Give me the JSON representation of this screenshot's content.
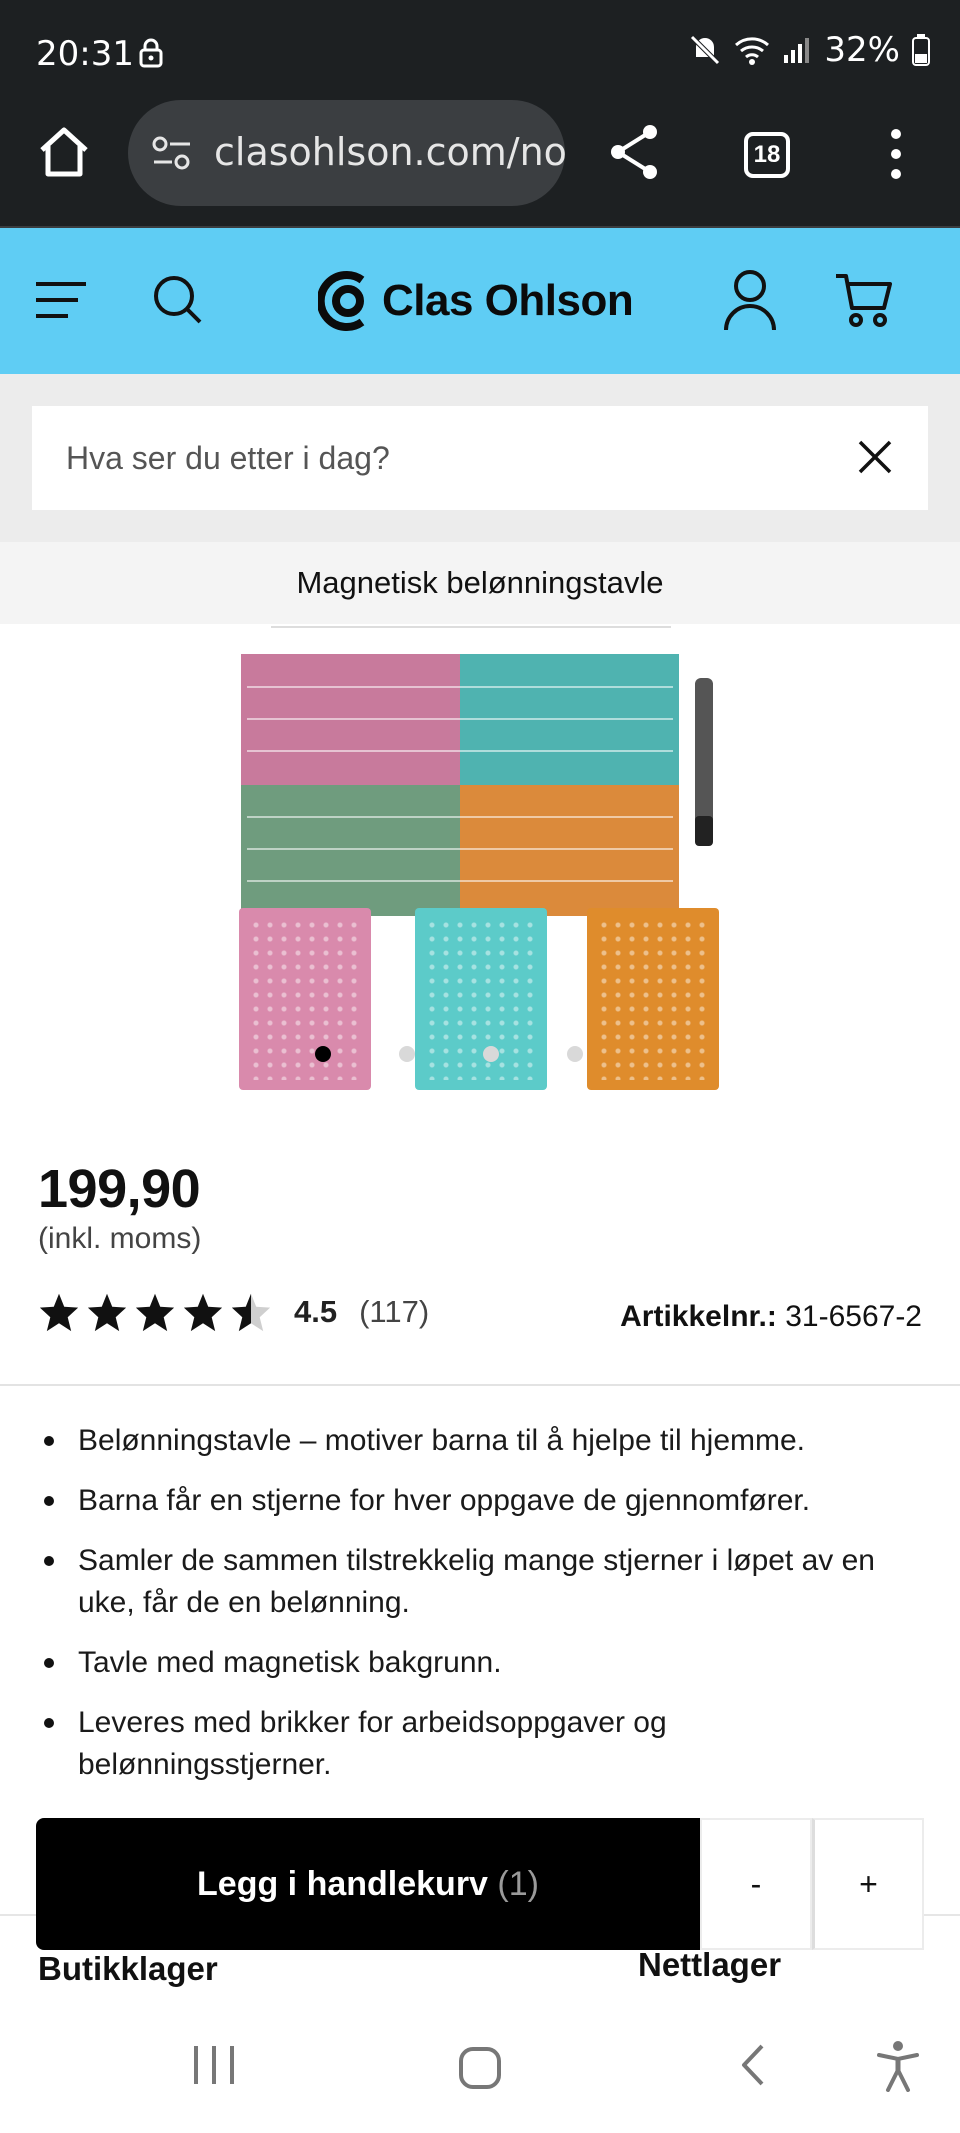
{
  "status_bar": {
    "time": "20:31",
    "battery": "32%"
  },
  "browser": {
    "url": "clasohlson.com/no/",
    "tab_count": "18"
  },
  "site": {
    "brand": "Clas Ohlson",
    "brand_color": "#5fcdf4"
  },
  "search": {
    "placeholder": "Hva ser du etter i dag?"
  },
  "product": {
    "title": "Magnetisk belønningstavle",
    "price": "199,90",
    "vat_note": "(inkl. moms)",
    "rating_value": "4.5",
    "rating_stars": 4.5,
    "rating_count": "(117)",
    "article_label": "Artikkelnr.:",
    "article_number": "31-6567-2",
    "image_index": 1,
    "image_total": 4,
    "bullets": [
      "Belønningstavle – motiver barna til å hjelpe til hjemme.",
      "Barna får en stjerne for hver oppgave de gjennomfører.",
      "Samler de sammen tilstrekkelig mange stjerner i løpet av en uke, får de en belønning.",
      "Tavle med magnetisk bakgrunn.",
      "Leveres med brikker for arbeidsoppgaver og belønningsstjerner."
    ]
  },
  "cart": {
    "add_label": "Legg i handlekurv",
    "count": "(1)",
    "minus": "-",
    "plus": "+"
  },
  "stock": {
    "store": "Butikklager",
    "web": "Nettlager"
  }
}
